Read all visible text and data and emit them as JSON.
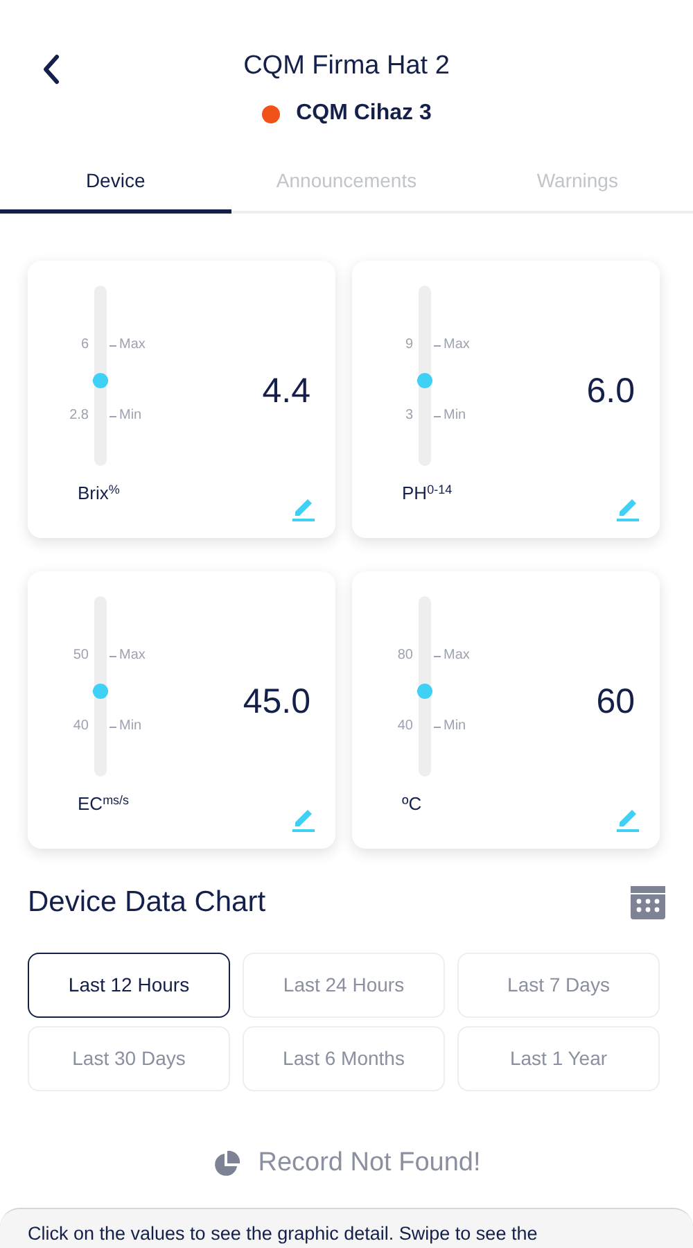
{
  "header": {
    "title": "CQM Firma Hat 2",
    "device": {
      "name": "CQM Cihaz 3",
      "color": "#f0521a"
    }
  },
  "tabs": [
    {
      "label": "Device",
      "selected": true
    },
    {
      "label": "Announcements",
      "selected": false
    },
    {
      "label": "Warnings",
      "selected": false
    }
  ],
  "sensors": [
    {
      "unit": "Brix$^{%}$",
      "max": "6",
      "max_label": "Max",
      "min": "2.8",
      "min_label": "Min",
      "level": 0.47,
      "value": "4.4"
    },
    {
      "unit": "PH$^{0-14}$",
      "max": "9",
      "max_label": "Max",
      "min": "3",
      "min_label": "Min",
      "level": 0.47,
      "value": "6.0"
    },
    {
      "unit": "EC$^{ms/s}$",
      "max": "50",
      "max_label": "Max",
      "min": "40",
      "min_label": "Min",
      "level": 0.47,
      "value": "45.0"
    },
    {
      "unit": "ºC",
      "max": "80",
      "max_label": "Max",
      "min": "40",
      "min_label": "Min",
      "level": 0.47,
      "value": "60"
    }
  ],
  "chart_section": {
    "title": "Device Data Chart",
    "ranges": [
      {
        "label": "Last 12 Hours",
        "selected": true
      },
      {
        "label": "Last 24 Hours",
        "selected": false
      },
      {
        "label": "Last 7 Days",
        "selected": false
      },
      {
        "label": "Last 30 Days",
        "selected": false
      },
      {
        "label": "Last 6 Months",
        "selected": false
      },
      {
        "label": "Last 1 Year",
        "selected": false
      }
    ],
    "empty_message": "Record Not Found!"
  },
  "hint": "Click on the values to see the graphic detail. Swipe to see the"
}
